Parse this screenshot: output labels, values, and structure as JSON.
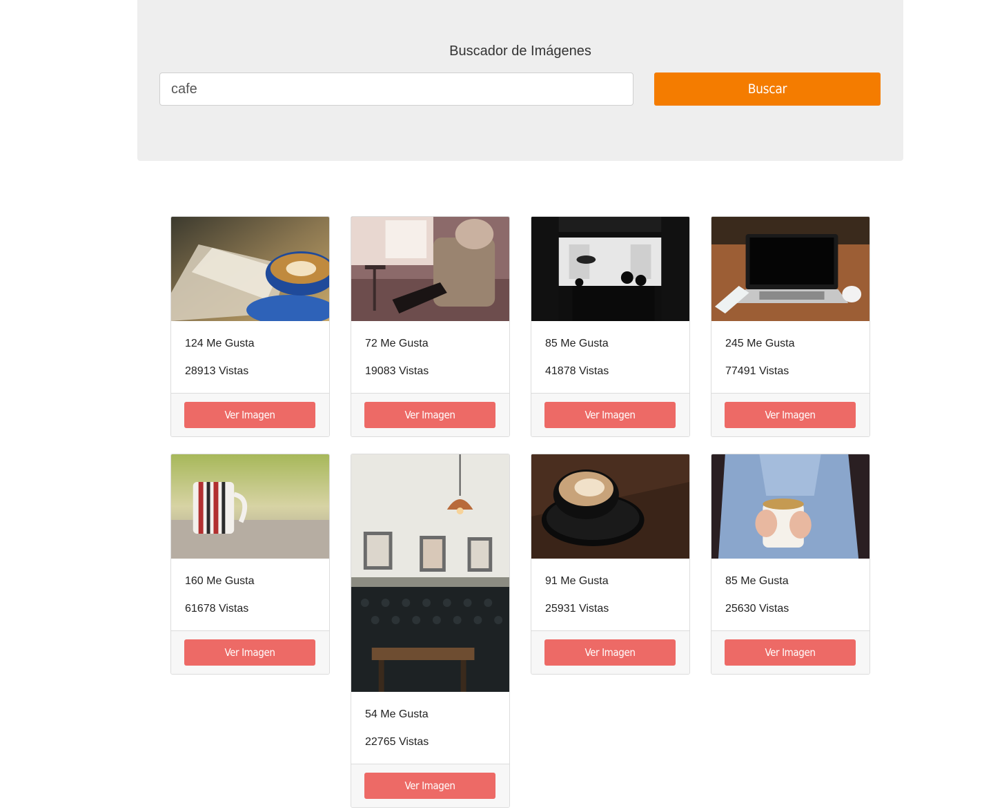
{
  "header": {
    "title": "Buscador de Imágenes",
    "search_value": "cafe",
    "search_button": "Buscar"
  },
  "colors": {
    "jumbotron_bg": "#eeeeee",
    "search_button": "#f47c00",
    "view_button": "#ed6a66"
  },
  "results": [
    {
      "likes": "124 Me Gusta",
      "views": "28913 Vistas",
      "button": "Ver Imagen",
      "image": "coffee-cup-and-book"
    },
    {
      "likes": "72 Me Gusta",
      "views": "19083 Vistas",
      "button": "Ver Imagen",
      "image": "woman-in-armchair"
    },
    {
      "likes": "85 Me Gusta",
      "views": "41878 Vistas",
      "button": "Ver Imagen",
      "image": "cafe-interior-silhouettes"
    },
    {
      "likes": "245 Me Gusta",
      "views": "77491 Vistas",
      "button": "Ver Imagen",
      "image": "laptop-and-coffee"
    },
    {
      "likes": "160 Me Gusta",
      "views": "61678 Vistas",
      "button": "Ver Imagen",
      "image": "striped-mug"
    },
    {
      "likes": "54 Me Gusta",
      "views": "22765 Vistas",
      "button": "Ver Imagen",
      "image": "cafe-leather-sofa"
    },
    {
      "likes": "91 Me Gusta",
      "views": "25931 Vistas",
      "button": "Ver Imagen",
      "image": "cappuccino-on-saucer"
    },
    {
      "likes": "85 Me Gusta",
      "views": "25630 Vistas",
      "button": "Ver Imagen",
      "image": "hands-holding-mug"
    }
  ]
}
